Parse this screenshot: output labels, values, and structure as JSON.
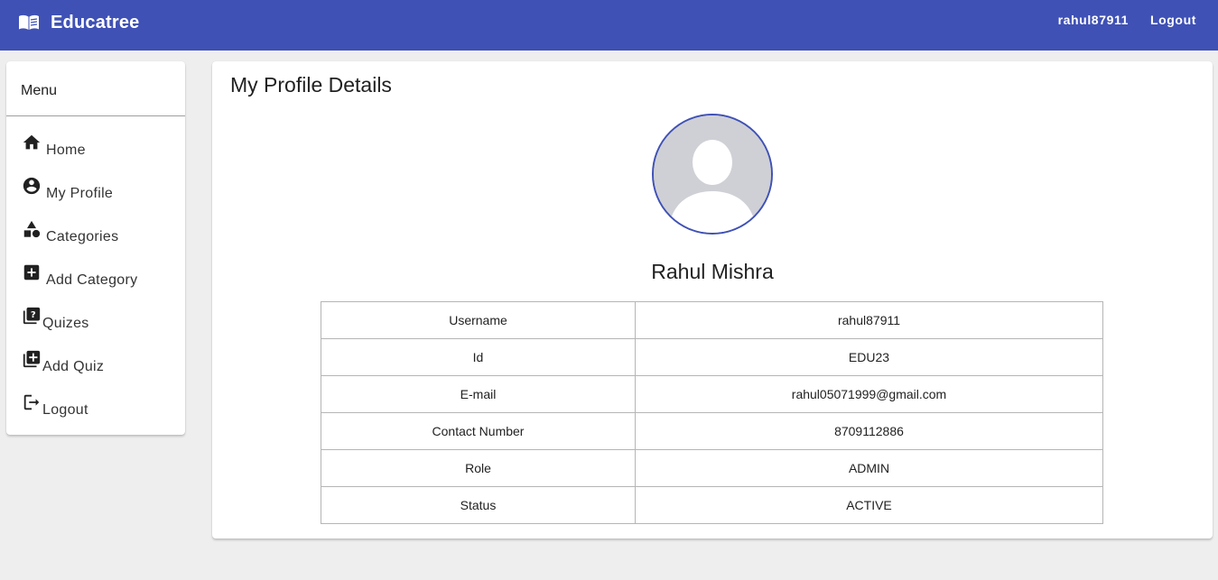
{
  "header": {
    "brand": "Educatree",
    "username": "rahul87911",
    "logout_label": "Logout"
  },
  "sidebar": {
    "title": "Menu",
    "items": [
      {
        "label": "Home",
        "icon": "home-icon"
      },
      {
        "label": "My Profile",
        "icon": "account-circle-icon"
      },
      {
        "label": "Categories",
        "icon": "category-icon"
      },
      {
        "label": "Add Category",
        "icon": "add-box-icon"
      },
      {
        "label": "Quizes",
        "icon": "quiz-icon"
      },
      {
        "label": "Add Quiz",
        "icon": "library-add-icon"
      },
      {
        "label": "Logout",
        "icon": "logout-icon"
      }
    ]
  },
  "main": {
    "title": "My Profile Details",
    "full_name": "Rahul Mishra",
    "details": [
      {
        "key": "Username",
        "value": "rahul87911"
      },
      {
        "key": "Id",
        "value": "EDU23"
      },
      {
        "key": "E-mail",
        "value": "rahul05071999@gmail.com"
      },
      {
        "key": "Contact Number",
        "value": "8709112886"
      },
      {
        "key": "Role",
        "value": "ADMIN"
      },
      {
        "key": "Status",
        "value": "ACTIVE"
      }
    ]
  },
  "colors": {
    "primary": "#3f51b5",
    "background": "#eeeeee",
    "avatar_bg": "#cfd0d6"
  }
}
